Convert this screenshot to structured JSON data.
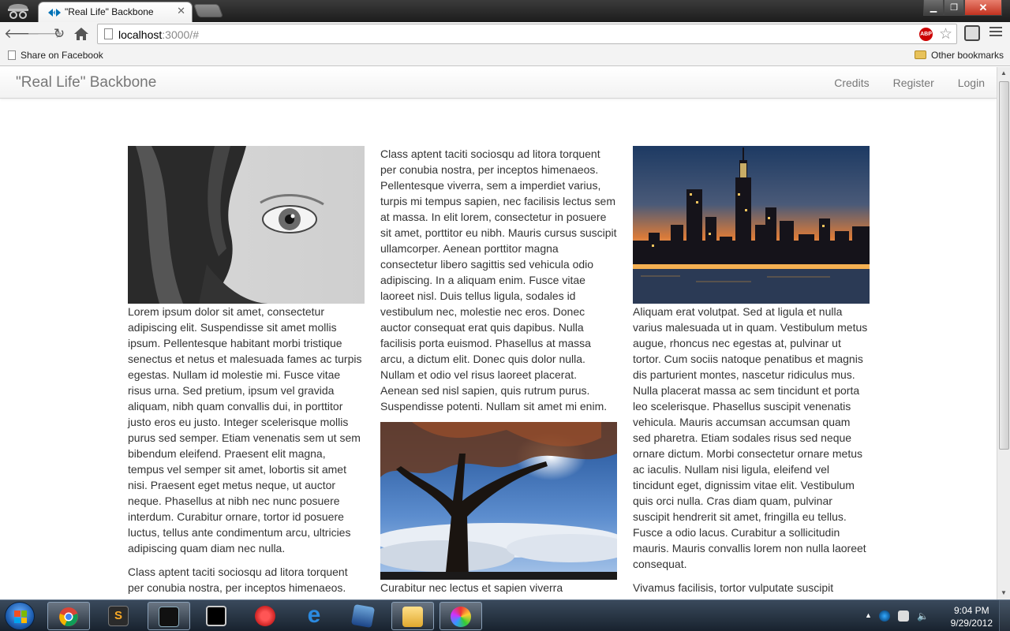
{
  "browser": {
    "tab_title": "\"Real Life\" Backbone",
    "url_host": "localhost",
    "url_rest": ":3000/#",
    "bookmarks": {
      "share": "Share on Facebook",
      "other": "Other bookmarks"
    },
    "adblock_label": "ABP"
  },
  "navbar": {
    "brand": "\"Real Life\" Backbone",
    "links": [
      "Credits",
      "Register",
      "Login"
    ]
  },
  "columns": {
    "col1": {
      "image": "woman-eye-photo",
      "paragraphs": [
        "Lorem ipsum dolor sit amet, consectetur adipiscing elit. Suspendisse sit amet mollis ipsum. Pellentesque habitant morbi tristique senectus et netus et malesuada fames ac turpis egestas. Nullam id molestie mi. Fusce vitae risus urna. Sed pretium, ipsum vel gravida aliquam, nibh quam convallis dui, in porttitor justo eros eu justo. Integer scelerisque mollis purus sed semper. Etiam venenatis sem ut sem bibendum eleifend. Praesent elit magna, tempus vel semper sit amet, lobortis sit amet nisi. Praesent eget metus neque, ut auctor neque. Phasellus at nibh nec nunc posuere interdum. Curabitur ornare, tortor id posuere luctus, tellus ante condimentum arcu, ultricies adipiscing quam diam nec nulla.",
        "Class aptent taciti sociosqu ad litora torquent per conubia nostra, per inceptos himenaeos."
      ]
    },
    "col2": {
      "paragraphs_top": [
        "Class aptent taciti sociosqu ad litora torquent per conubia nostra, per inceptos himenaeos. Pellentesque viverra, sem a imperdiet varius, turpis mi tempus sapien, nec facilisis lectus sem at massa. In elit lorem, consectetur in posuere sit amet, porttitor eu nibh. Mauris cursus suscipit ullamcorper. Aenean porttitor magna consectetur libero sagittis sed vehicula odio adipiscing. In a aliquam enim. Fusce vitae laoreet nisl. Duis tellus ligula, sodales id vestibulum nec, molestie nec eros. Donec auctor consequat erat quis dapibus. Nulla facilisis porta euismod. Phasellus at massa arcu, a dictum elit. Donec quis dolor nulla. Nullam et odio vel risus laoreet placerat. Aenean sed nisl sapien, quis rutrum purus. Suspendisse potenti. Nullam sit amet mi enim."
      ],
      "image": "tree-sky-photo",
      "paragraphs_bottom": [
        "Curabitur nec lectus et sapien viverra"
      ]
    },
    "col3": {
      "image": "city-skyline-photo",
      "paragraphs": [
        "Aliquam erat volutpat. Sed at ligula et nulla varius malesuada ut in quam. Vestibulum metus augue, rhoncus nec egestas at, pulvinar ut tortor. Cum sociis natoque penatibus et magnis dis parturient montes, nascetur ridiculus mus. Nulla placerat massa ac sem tincidunt et porta leo scelerisque. Phasellus suscipit venenatis vehicula. Mauris accumsan accumsan quam sed pharetra. Etiam sodales risus sed neque ornare dictum. Morbi consectetur ornare metus ac iaculis. Nullam nisi ligula, eleifend vel tincidunt eget, dignissim vitae elit. Vestibulum quis orci nulla. Cras diam quam, pulvinar suscipit hendrerit sit amet, fringilla eu tellus. Fusce a odio lacus. Curabitur a sollicitudin mauris. Mauris convallis lorem non nulla laoreet consequat.",
        "Vivamus facilisis, tortor vulputate suscipit"
      ]
    }
  },
  "taskbar": {
    "time": "9:04 PM",
    "date": "9/29/2012",
    "sublime_glyph": "S",
    "apps": [
      "chrome",
      "sublime-text",
      "terminal-app",
      "cmd",
      "snipping-tool",
      "internet-explorer",
      "virtualbox",
      "file-explorer",
      "paint"
    ]
  }
}
